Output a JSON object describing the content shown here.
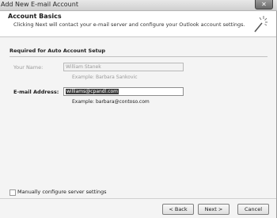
{
  "window": {
    "title": "Add New E-mail Account",
    "close_glyph": "✕"
  },
  "header": {
    "title": "Account Basics",
    "subtitle": "Clicking Next will contact your e-mail server and configure your Outlook account settings.",
    "icon": "wand-icon"
  },
  "section": {
    "title": "Required for Auto Account Setup"
  },
  "form": {
    "your_name": {
      "label": "Your Name:",
      "value": "William Stanek",
      "example": "Example: Barbara Sankovic"
    },
    "email": {
      "label": "E-mail Address:",
      "value": "williams@cpandl.com",
      "example": "Example: barbara@contoso.com"
    }
  },
  "manual": {
    "label": "Manually configure server settings",
    "checked": false
  },
  "buttons": {
    "back": "< Back",
    "next": "Next >",
    "cancel": "Cancel"
  }
}
